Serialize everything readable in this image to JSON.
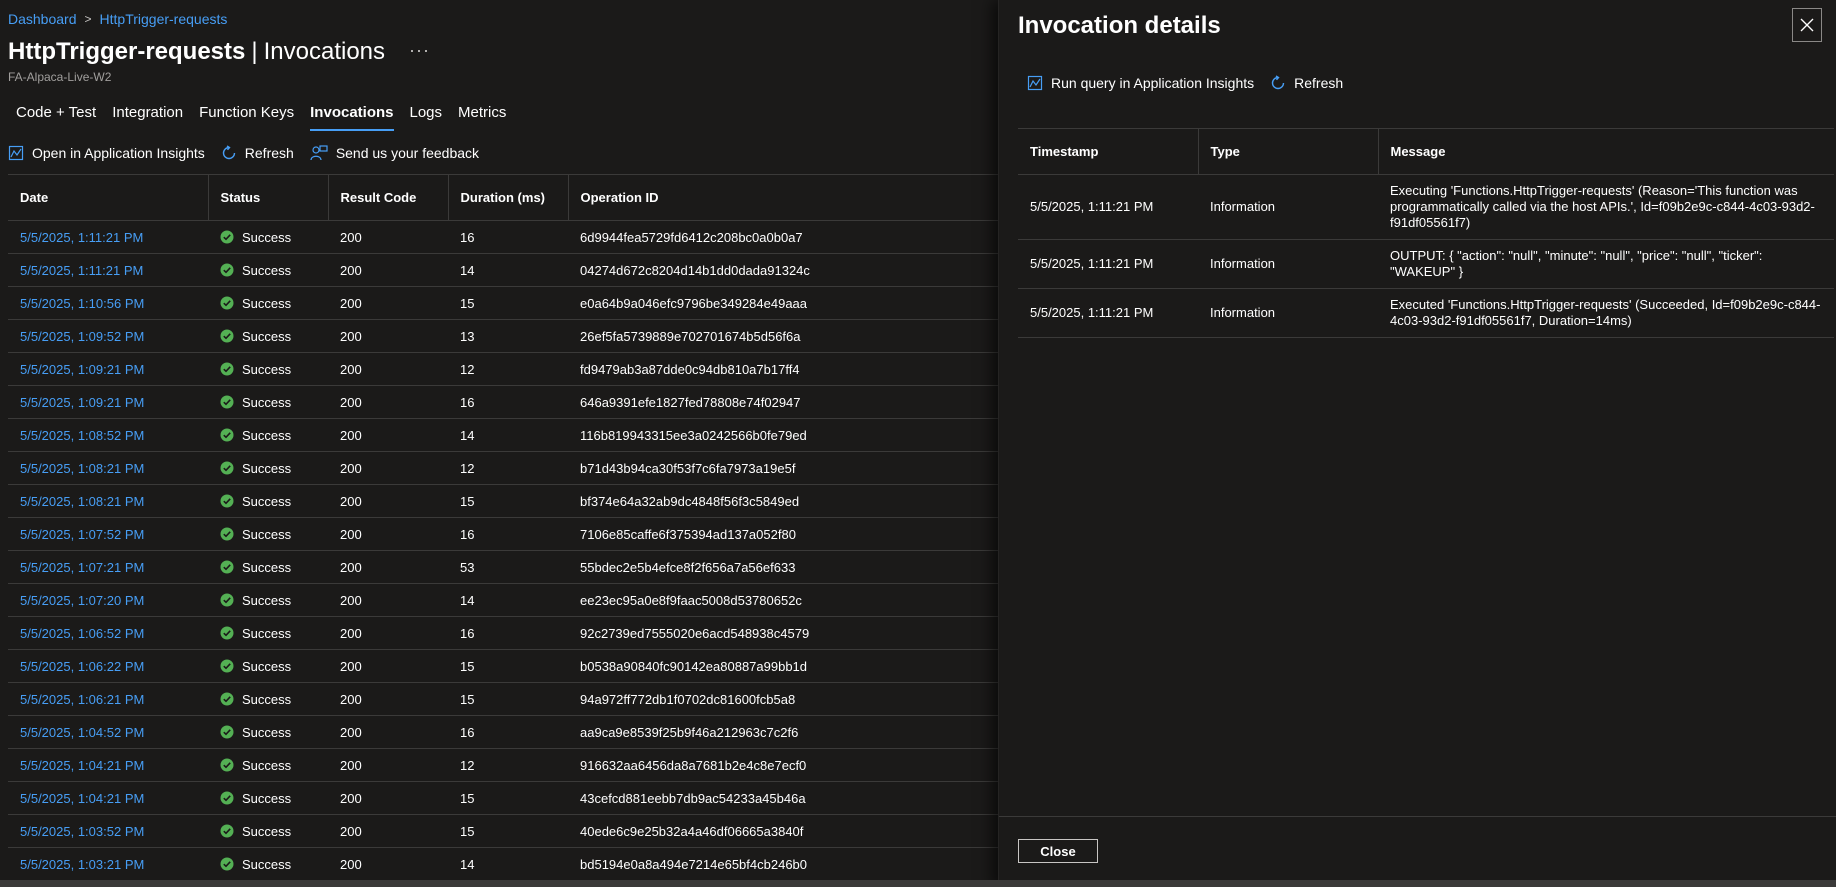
{
  "breadcrumb": {
    "items": [
      "Dashboard",
      "HttpTrigger-requests"
    ],
    "sep": ">"
  },
  "header": {
    "title_bold": "HttpTrigger-requests",
    "title_pipe": "|",
    "title_light": "Invocations",
    "more": "···",
    "subtitle": "FA-Alpaca-Live-W2"
  },
  "tabs": [
    {
      "label": "Code + Test"
    },
    {
      "label": "Integration"
    },
    {
      "label": "Function Keys"
    },
    {
      "label": "Invocations"
    },
    {
      "label": "Logs"
    },
    {
      "label": "Metrics"
    }
  ],
  "toolbar": {
    "open_insights": "Open in Application Insights",
    "refresh": "Refresh",
    "feedback": "Send us your feedback"
  },
  "table": {
    "headers": [
      "Date",
      "Status",
      "Result Code",
      "Duration (ms)",
      "Operation ID"
    ],
    "rows": [
      {
        "date": "5/5/2025, 1:11:21 PM",
        "status": "Success",
        "code": "200",
        "duration": "16",
        "op": "6d9944fea5729fd6412c208bc0a0b0a7"
      },
      {
        "date": "5/5/2025, 1:11:21 PM",
        "status": "Success",
        "code": "200",
        "duration": "14",
        "op": "04274d672c8204d14b1dd0dada91324c"
      },
      {
        "date": "5/5/2025, 1:10:56 PM",
        "status": "Success",
        "code": "200",
        "duration": "15",
        "op": "e0a64b9a046efc9796be349284e49aaa"
      },
      {
        "date": "5/5/2025, 1:09:52 PM",
        "status": "Success",
        "code": "200",
        "duration": "13",
        "op": "26ef5fa5739889e702701674b5d56f6a"
      },
      {
        "date": "5/5/2025, 1:09:21 PM",
        "status": "Success",
        "code": "200",
        "duration": "12",
        "op": "fd9479ab3a87dde0c94db810a7b17ff4"
      },
      {
        "date": "5/5/2025, 1:09:21 PM",
        "status": "Success",
        "code": "200",
        "duration": "16",
        "op": "646a9391efe1827fed78808e74f02947"
      },
      {
        "date": "5/5/2025, 1:08:52 PM",
        "status": "Success",
        "code": "200",
        "duration": "14",
        "op": "116b819943315ee3a0242566b0fe79ed"
      },
      {
        "date": "5/5/2025, 1:08:21 PM",
        "status": "Success",
        "code": "200",
        "duration": "12",
        "op": "b71d43b94ca30f53f7c6fa7973a19e5f"
      },
      {
        "date": "5/5/2025, 1:08:21 PM",
        "status": "Success",
        "code": "200",
        "duration": "15",
        "op": "bf374e64a32ab9dc4848f56f3c5849ed"
      },
      {
        "date": "5/5/2025, 1:07:52 PM",
        "status": "Success",
        "code": "200",
        "duration": "16",
        "op": "7106e85caffe6f375394ad137a052f80"
      },
      {
        "date": "5/5/2025, 1:07:21 PM",
        "status": "Success",
        "code": "200",
        "duration": "53",
        "op": "55bdec2e5b4efce8f2f656a7a56ef633"
      },
      {
        "date": "5/5/2025, 1:07:20 PM",
        "status": "Success",
        "code": "200",
        "duration": "14",
        "op": "ee23ec95a0e8f9faac5008d53780652c"
      },
      {
        "date": "5/5/2025, 1:06:52 PM",
        "status": "Success",
        "code": "200",
        "duration": "16",
        "op": "92c2739ed7555020e6acd548938c4579"
      },
      {
        "date": "5/5/2025, 1:06:22 PM",
        "status": "Success",
        "code": "200",
        "duration": "15",
        "op": "b0538a90840fc90142ea80887a99bb1d"
      },
      {
        "date": "5/5/2025, 1:06:21 PM",
        "status": "Success",
        "code": "200",
        "duration": "15",
        "op": "94a972ff772db1f0702dc81600fcb5a8"
      },
      {
        "date": "5/5/2025, 1:04:52 PM",
        "status": "Success",
        "code": "200",
        "duration": "16",
        "op": "aa9ca9e8539f25b9f46a212963c7c2f6"
      },
      {
        "date": "5/5/2025, 1:04:21 PM",
        "status": "Success",
        "code": "200",
        "duration": "12",
        "op": "916632aa6456da8a7681b2e4c8e7ecf0"
      },
      {
        "date": "5/5/2025, 1:04:21 PM",
        "status": "Success",
        "code": "200",
        "duration": "15",
        "op": "43cefcd881eebb7db9ac54233a45b46a"
      },
      {
        "date": "5/5/2025, 1:03:52 PM",
        "status": "Success",
        "code": "200",
        "duration": "15",
        "op": "40ede6c9e25b32a4a46df06665a3840f"
      },
      {
        "date": "5/5/2025, 1:03:21 PM",
        "status": "Success",
        "code": "200",
        "duration": "14",
        "op": "bd5194e0a8a494e7214e65bf4cb246b0"
      }
    ]
  },
  "panel": {
    "title": "Invocation details",
    "run_query": "Run query in Application Insights",
    "refresh": "Refresh",
    "headers": [
      "Timestamp",
      "Type",
      "Message"
    ],
    "rows": [
      {
        "ts": "5/5/2025, 1:11:21 PM",
        "type": "Information",
        "msg": "Executing 'Functions.HttpTrigger-requests' (Reason='This function was programmatically called via the host APIs.', Id=f09b2e9c-c844-4c03-93d2-f91df05561f7)"
      },
      {
        "ts": "5/5/2025, 1:11:21 PM",
        "type": "Information",
        "msg": "OUTPUT: { \"action\": \"null\", \"minute\": \"null\", \"price\": \"null\", \"ticker\": \"WAKEUP\" }"
      },
      {
        "ts": "5/5/2025, 1:11:21 PM",
        "type": "Information",
        "msg": "Executed 'Functions.HttpTrigger-requests' (Succeeded, Id=f09b2e9c-c844-4c03-93d2-f91df05561f7, Duration=14ms)"
      }
    ],
    "close": "Close"
  },
  "colors": {
    "accent": "#479ef5",
    "success": "#54b054",
    "background": "#1b1a19"
  }
}
